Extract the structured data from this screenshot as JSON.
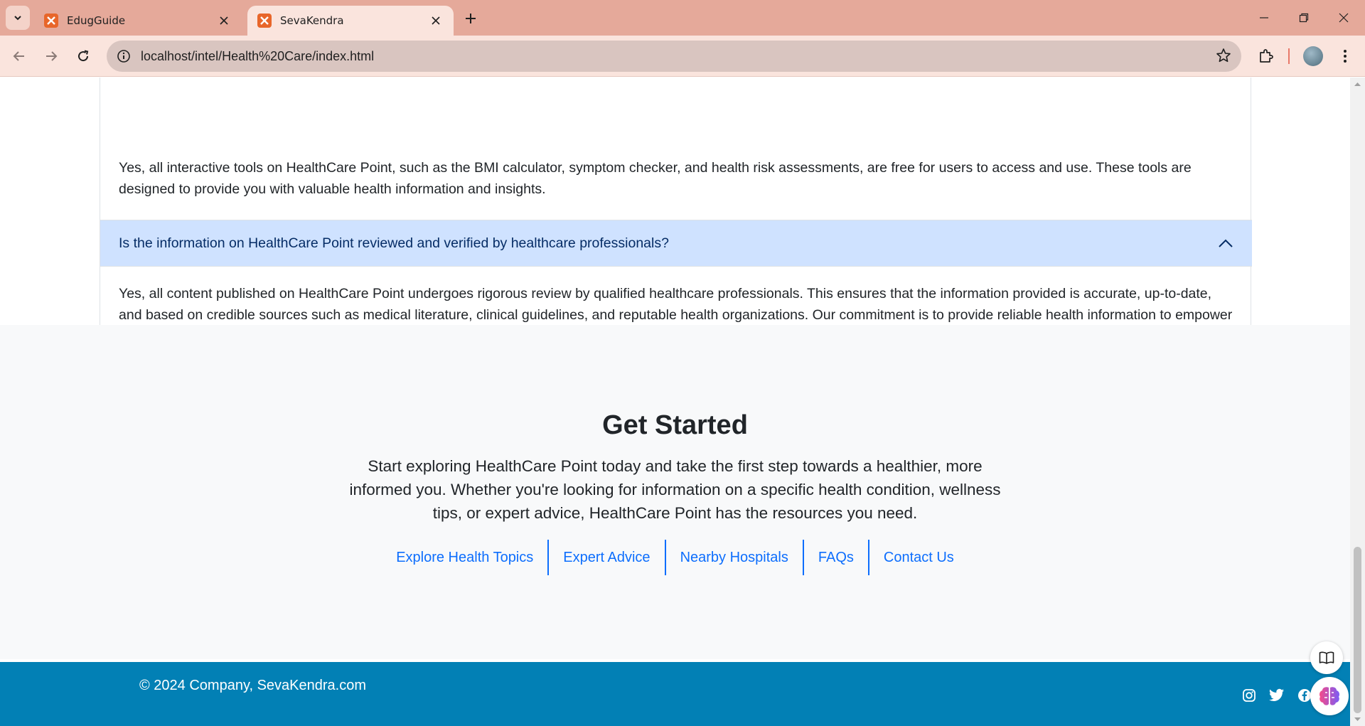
{
  "colors": {
    "tabbar_bg": "#e5a99a",
    "toolbar_bg": "#fae4dd",
    "accordion_active_bg": "#cfe2ff",
    "link_color": "#0d6efd",
    "footer_bg": "#0280b5",
    "section_bg": "#f8f9fa"
  },
  "browser": {
    "tabs": [
      {
        "title": "EdugGuide",
        "active": false,
        "favicon": "xampp-icon"
      },
      {
        "title": "SevaKendra",
        "active": true,
        "favicon": "xampp-icon"
      }
    ],
    "url": "localhost/intel/Health%20Care/index.html"
  },
  "faq": {
    "answer_1": "Yes, all interactive tools on HealthCare Point, such as the BMI calculator, symptom checker, and health risk assessments, are free for users to access and use. These tools are designed to provide you with valuable health information and insights.",
    "question_2": "Is the information on HealthCare Point reviewed and verified by healthcare professionals?",
    "answer_2": "Yes, all content published on HealthCare Point undergoes rigorous review by qualified healthcare professionals. This ensures that the information provided is accurate, up-to-date, and based on credible sources such as medical literature, clinical guidelines, and reputable health organizations. Our commitment is to provide reliable health information to empower users to make informed decisions about their health."
  },
  "get_started": {
    "title": "Get Started",
    "text": "Start exploring HealthCare Point today and take the first step towards a healthier, more informed you. Whether you're looking for information on a specific health condition, wellness tips, or expert advice, HealthCare Point has the resources you need.",
    "links": [
      "Explore Health Topics",
      "Expert Advice",
      "Nearby Hospitals",
      "FAQs",
      "Contact Us"
    ]
  },
  "footer": {
    "copyright": "© 2024 Company, SevaKendra.com",
    "social_icons": [
      "instagram-icon",
      "twitter-icon",
      "facebook-icon"
    ]
  }
}
